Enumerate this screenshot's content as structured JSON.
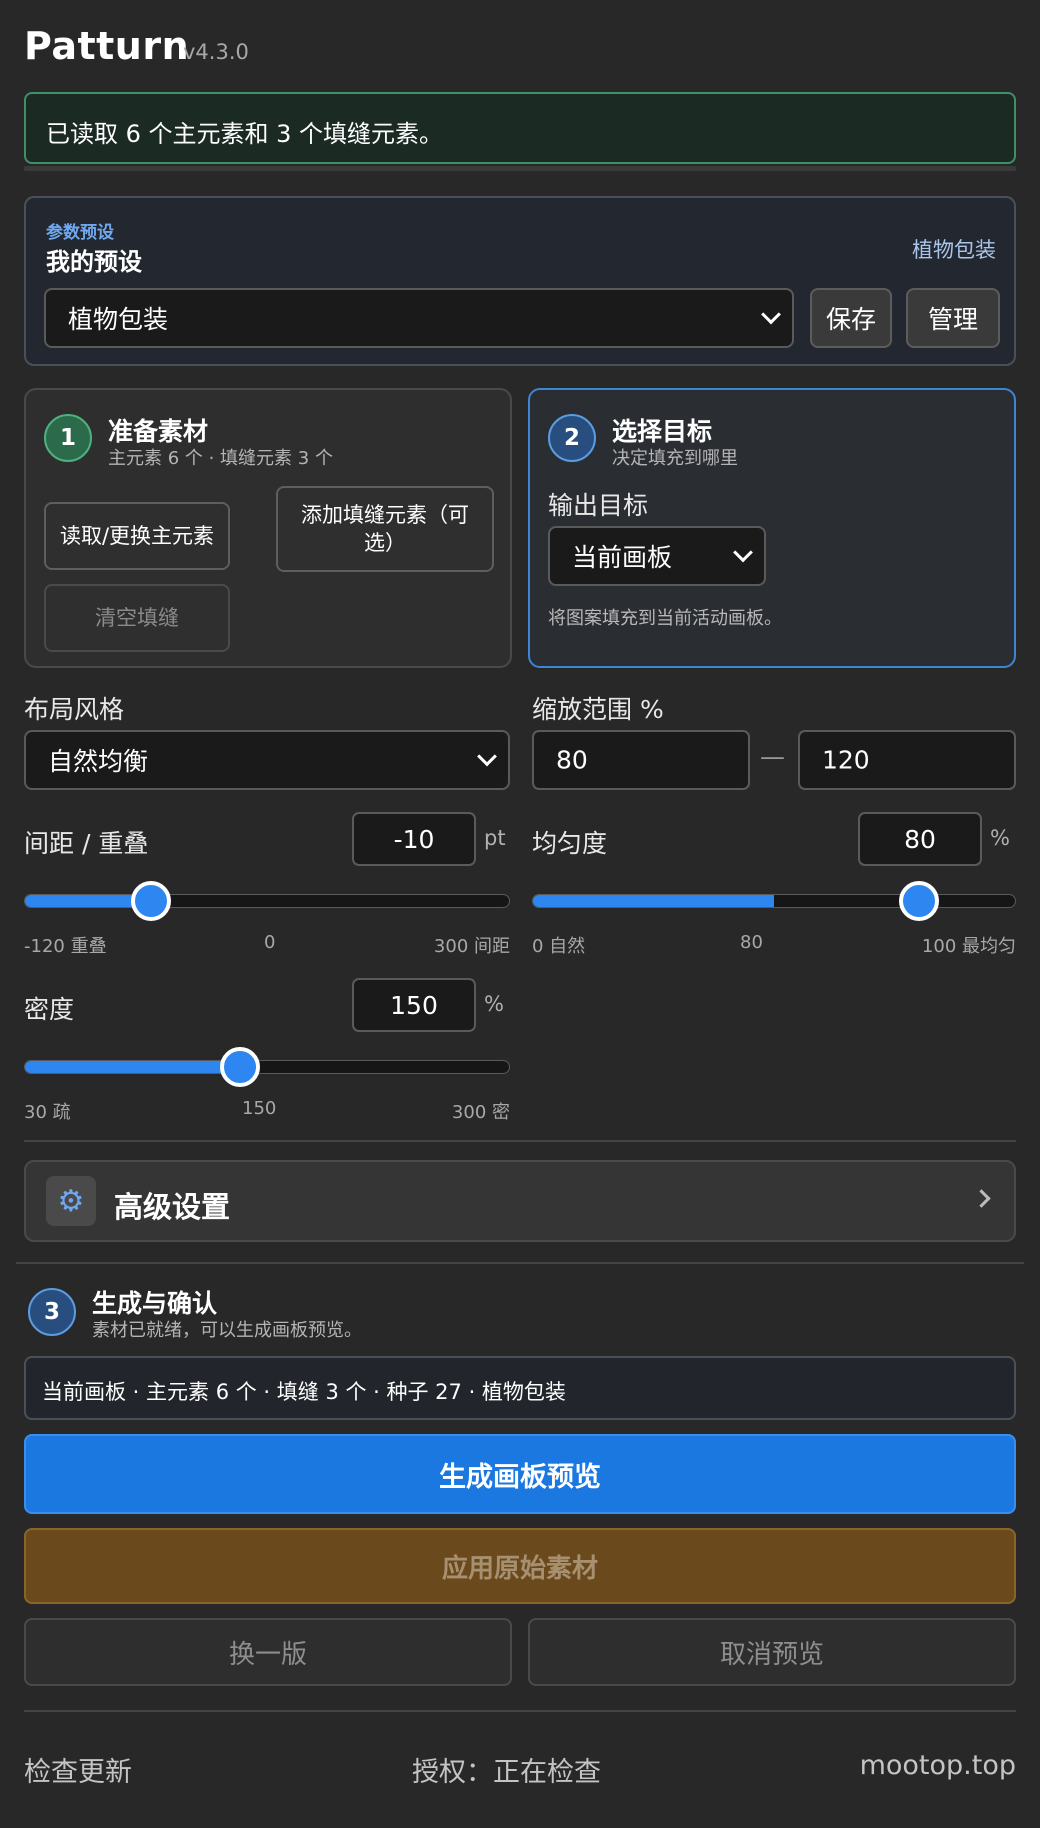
{
  "app": {
    "name": "Patturn",
    "version": "v4.3.0"
  },
  "notice": {
    "text": "已读取 6 个主元素和 3 个填缝元素。"
  },
  "preset": {
    "kicker": "参数预设",
    "title": "我的预设",
    "current_name": "植物包装",
    "select_value": "植物包装",
    "save_label": "保存",
    "manage_label": "管理"
  },
  "step1": {
    "number": "1",
    "title": "准备素材",
    "subtitle": "主元素 6 个 · 填缝元素 3 个",
    "load_main_label": "读取/更换主元素",
    "add_filler_label": "添加填缝元素（可选）",
    "clear_filler_label": "清空填缝"
  },
  "step2": {
    "number": "2",
    "title": "选择目标",
    "subtitle": "决定填充到哪里",
    "output_label": "输出目标",
    "output_value": "当前画板",
    "hint": "将图案填充到当前活动画板。"
  },
  "layout": {
    "label": "布局风格",
    "value": "自然均衡"
  },
  "scale": {
    "label": "缩放范围 %",
    "min": "80",
    "separator": "—",
    "max": "120"
  },
  "spacing": {
    "label": "间距 / 重叠",
    "value": "-10",
    "unit": "pt",
    "tick_left": "-120 重叠",
    "tick_mid": "0",
    "tick_right": "300 间距",
    "min": -120,
    "max": 300,
    "current": -10,
    "fill_end": 0
  },
  "uniformity": {
    "label": "均匀度",
    "value": "80",
    "unit": "%",
    "tick_left": "0 自然",
    "tick_mid": "80",
    "tick_right": "100 最均匀",
    "min": 0,
    "max": 100,
    "current": 80,
    "fill_end": 50
  },
  "density": {
    "label": "密度",
    "value": "150",
    "unit": "%",
    "tick_left": "30 疏",
    "tick_mid": "150",
    "tick_right": "300 密",
    "min": 30,
    "max": 300,
    "current": 150,
    "fill_end": 150
  },
  "advanced": {
    "label": "高级设置",
    "icon": "gear-icon"
  },
  "step3": {
    "number": "3",
    "title": "生成与确认",
    "subtitle": "素材已就绪，可以生成画板预览。"
  },
  "summary": {
    "text": "当前画板 · 主元素 6 个 · 填缝 3 个 · 种子 27 · 植物包装"
  },
  "actions": {
    "generate_label": "生成画板预览",
    "apply_label": "应用原始素材",
    "reroll_label": "换一版",
    "cancel_label": "取消预览"
  },
  "footer": {
    "check_update": "检查更新",
    "license": "授权：正在检查",
    "website": "mootop.top"
  },
  "colors": {
    "accent": "#2e87f0",
    "success_border": "#3f8f67",
    "apply": "#6a4a1c",
    "background": "#282828"
  }
}
